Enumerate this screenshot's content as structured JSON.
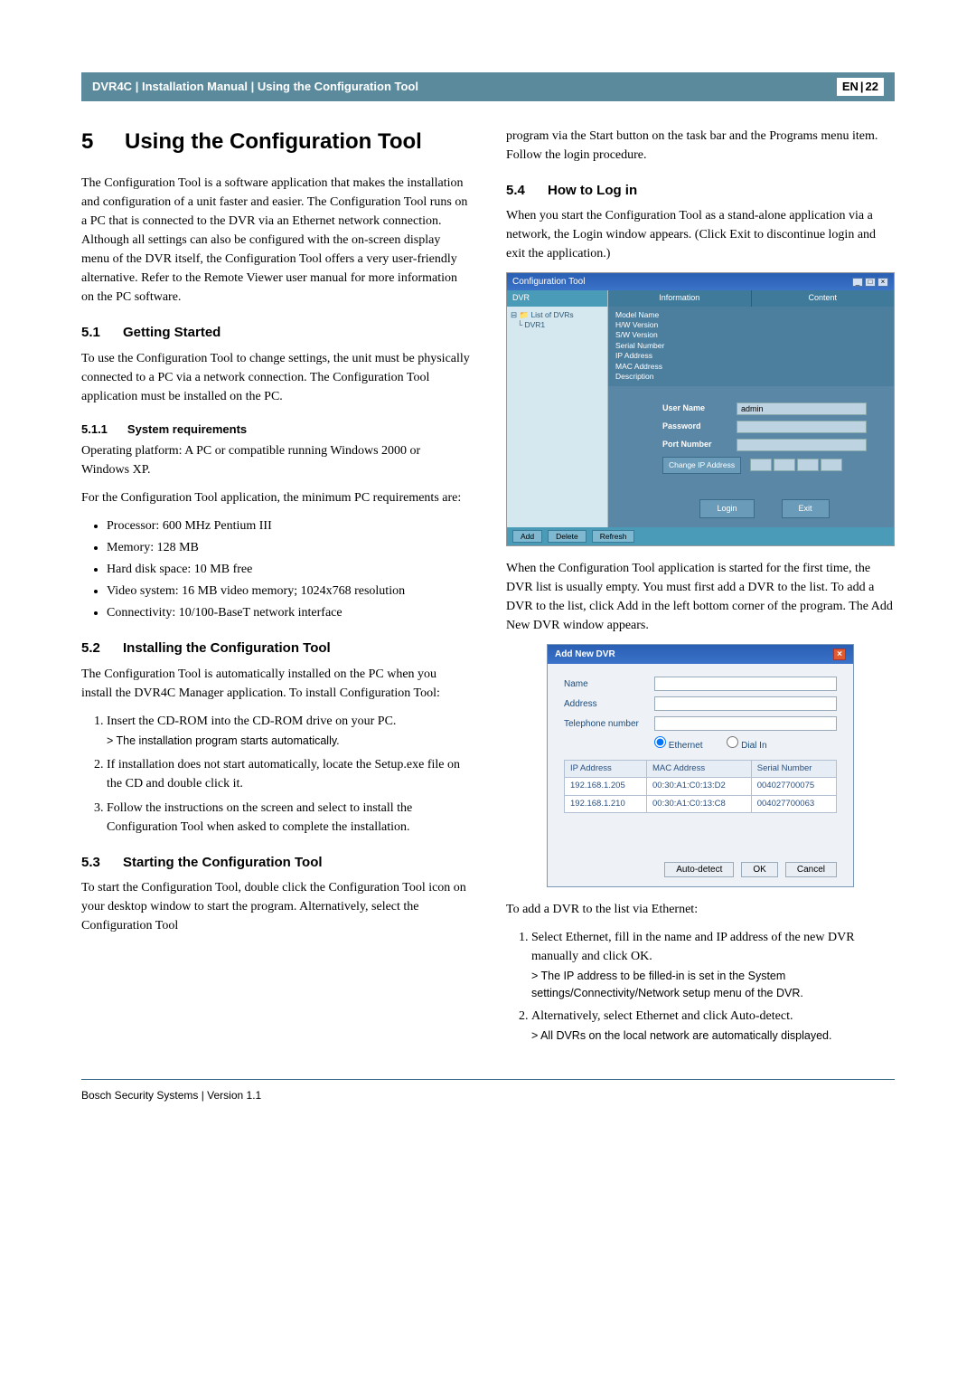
{
  "header": {
    "product": "DVR4C",
    "manual": "Installation Manual",
    "section": "Using the Configuration Tool",
    "lang": "EN",
    "page": "22"
  },
  "h1_num": "5",
  "h1_text": "Using the Configuration Tool",
  "intro": "The Configuration Tool is a software application that makes the installation and configuration of a unit faster and easier. The Configuration Tool runs on a PC that is connected to the DVR via an Ethernet network connection. Although all settings can also be configured with the on-screen display menu of the DVR itself, the Configuration Tool offers a very user-friendly alternative. Refer to the Remote Viewer user manual for more information on the PC software.",
  "s51_num": "5.1",
  "s51_title": "Getting Started",
  "s51_p": "To use the Configuration Tool to change settings, the unit must be physically connected to a PC via a network connection. The Configuration Tool application must be installed on the PC.",
  "s511_num": "5.1.1",
  "s511_title": "System requirements",
  "s511_p1": "Operating platform: A PC or compatible running Windows 2000 or Windows XP.",
  "s511_p2": "For the Configuration Tool application, the minimum PC requirements are:",
  "reqs": [
    "Processor: 600 MHz Pentium III",
    "Memory: 128 MB",
    "Hard disk space: 10 MB free",
    "Video system: 16 MB video memory; 1024x768 resolution",
    "Connectivity: 10/100-BaseT network interface"
  ],
  "s52_num": "5.2",
  "s52_title": "Installing the Configuration Tool",
  "s52_p": "The Configuration Tool is automatically installed on the PC when you install the DVR4C Manager application. To install Configuration Tool:",
  "s52_steps": [
    {
      "t": "Insert the CD-ROM into the CD-ROM drive on your PC.",
      "n": "> The installation program starts automatically."
    },
    {
      "t": "If installation does not start automatically, locate the Setup.exe file on the CD and double click it.",
      "n": ""
    },
    {
      "t": "Follow the instructions on the screen and select to install the Configuration Tool when asked to complete the installation.",
      "n": ""
    }
  ],
  "s53_num": "5.3",
  "s53_title": "Starting the Configuration Tool",
  "s53_p": "To start the Configuration Tool, double click the Configuration Tool icon on your desktop window to start the program. Alternatively, select the Configuration Tool",
  "s53_cont": "program via the Start button on the task bar and the Programs menu item. Follow the login procedure.",
  "s54_num": "5.4",
  "s54_title": "How to Log in",
  "s54_p1": "When you start the Configuration Tool as a stand-alone application via a network, the Login window appears. (Click Exit to discontinue login and exit the application.)",
  "login_shot": {
    "title": "Configuration Tool",
    "tree_head": "DVR",
    "tree": [
      "List of DVRs",
      "DVR1"
    ],
    "cols": [
      "Information",
      "Content"
    ],
    "info_items": [
      "Model Name",
      "H/W Version",
      "S/W Version",
      "Serial Number",
      "IP Address",
      "MAC Address",
      "Description"
    ],
    "user_label": "User Name",
    "user_val": "admin",
    "pass_label": "Password",
    "port_label": "Port Number",
    "change_btn": "Change IP Address",
    "login_btn": "Login",
    "exit_btn": "Exit",
    "bottom_btns": [
      "Add",
      "Delete",
      "Refresh"
    ]
  },
  "s54_p2": "When the Configuration Tool application is started for the first time, the DVR list is usually empty. You must first add a DVR to the list. To add a DVR to the list, click Add in the left bottom corner of the program. The Add New DVR window appears.",
  "add_shot": {
    "title": "Add New DVR",
    "name": "Name",
    "addr": "Address",
    "tel": "Telephone number",
    "r_eth": "Ethernet",
    "r_dial": "Dial In",
    "th1": "IP Address",
    "th2": "MAC Address",
    "th3": "Serial Number",
    "rows": [
      [
        "192.168.1.205",
        "00:30:A1:C0:13:D2",
        "004027700075"
      ],
      [
        "192.168.1.210",
        "00:30:A1:C0:13:C8",
        "004027700063"
      ]
    ],
    "b_auto": "Auto-detect",
    "b_ok": "OK",
    "b_cancel": "Cancel"
  },
  "s54_p3": "To add a DVR to the list via Ethernet:",
  "s54_steps": [
    {
      "t": "Select Ethernet, fill in the name and IP address of the new DVR manually and click OK.",
      "n": "> The IP address to be filled-in is set in the System settings/Connectivity/Network setup menu of the DVR."
    },
    {
      "t": "Alternatively, select Ethernet and click Auto-detect.",
      "n": "> All DVRs on the local network are automatically displayed."
    }
  ],
  "footer": "Bosch Security Systems | Version 1.1"
}
